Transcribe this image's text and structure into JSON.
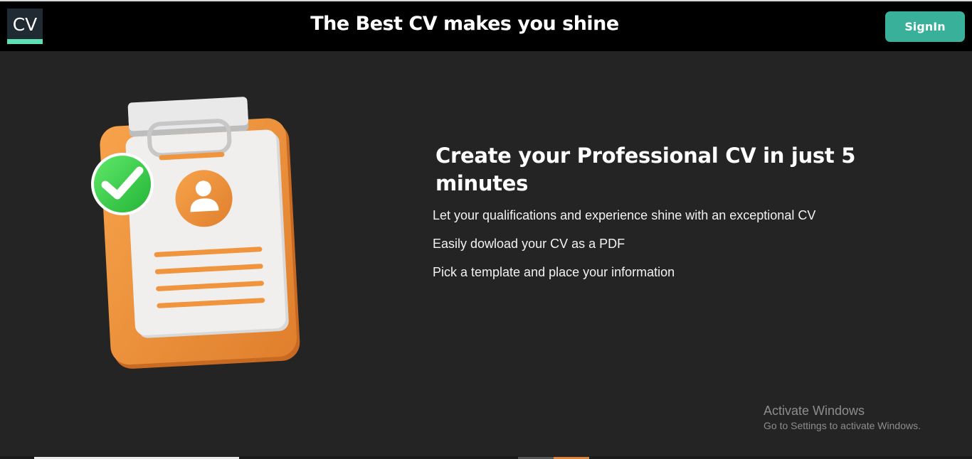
{
  "header": {
    "logo_text": "CV",
    "title": "The Best CV makes you shine",
    "signin_label": "SignIn"
  },
  "hero": {
    "heading": "Create your Professional CV in just 5 minutes",
    "points": [
      "Let your qualifications and experience shine with an exceptional CV",
      "Easily dowload your CV as a PDF",
      "Pick a template and place your information"
    ]
  },
  "watermark": {
    "line1": "Activate Windows",
    "line2": "Go to Settings to activate Windows."
  },
  "colors": {
    "background": "#242424",
    "header": "#000000",
    "accent": "#38b09a",
    "clipboard_orange": "#f0943e",
    "check_green": "#3ccf4a"
  },
  "icons": [
    "clipboard-illustration",
    "check-icon",
    "user-icon"
  ]
}
